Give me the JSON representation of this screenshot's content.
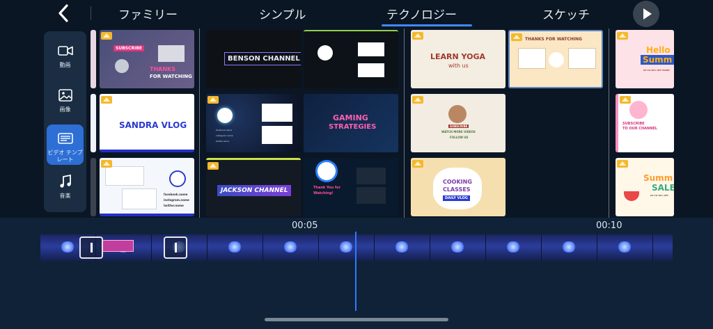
{
  "header": {
    "tabs": [
      {
        "label": "ファミリー"
      },
      {
        "label": "シンプル"
      },
      {
        "label": "テクノロジー",
        "active": true
      },
      {
        "label": "スケッチ"
      }
    ]
  },
  "sidebar": {
    "items": [
      {
        "label": "動画",
        "icon": "video-camera-icon"
      },
      {
        "label": "画像",
        "icon": "image-icon"
      },
      {
        "label": "ビデオ テンプレート",
        "icon": "template-icon",
        "active": true
      },
      {
        "label": "音楽",
        "icon": "music-note-icon"
      }
    ]
  },
  "templates": {
    "family": {
      "t1_a": "SUBSCRIBE",
      "t1_b": "THANKS",
      "t1_c": "FOR WATCHING",
      "t2": "SANDRA VLOG",
      "t3_a": "facebook.name",
      "t3_b": "instagram.name",
      "t3_c": "twitter.name"
    },
    "tech": {
      "t1": "BENSON CHANNEL",
      "t2_a": "facebook.name",
      "t2_b": "instagram.name",
      "t2_c": "twitter.name",
      "t3_a": "GAMING",
      "t3_b": "STRATEGIES",
      "t4": "JACKSON CHANNEL",
      "t5_a": "Thank You for",
      "t5_b": "Watching!"
    },
    "sketch": {
      "t1_a": "LEARN YOGA",
      "t1_b": "with us",
      "t2": "THANKS FOR WATCHING",
      "t3_a": "SUBSCRIBE",
      "t3_b": "WATCH MORE VIDEOS",
      "t3_c": "FOLLOW US",
      "t4_a": "COOKING",
      "t4_b": "CLASSES",
      "t4_c": "DAILY VLOG"
    },
    "next": {
      "t1_a": "Hello",
      "t1_b": "Summ",
      "t1_c": "UP TO 50% OFF EVERY",
      "t2_a": "SUBSCRIBE",
      "t2_b": "TO OUR CHANNEL",
      "t3_a": "Summ",
      "t3_b": "SALE",
      "t3_c": "UP TO 50% OFF"
    }
  },
  "timeline": {
    "marks": [
      "00:05",
      "00:10"
    ]
  },
  "colors": {
    "accent": "#3d8bff",
    "background": "#0b1624",
    "premium_badge": "#f5b82e"
  }
}
